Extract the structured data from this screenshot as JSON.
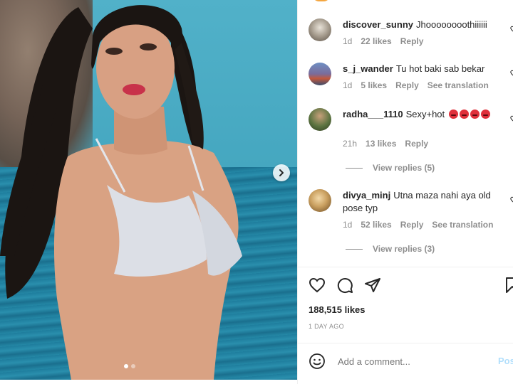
{
  "post": {
    "slide_count": 2,
    "active_slide": 1,
    "likes": "188,515 likes",
    "time_ago": "1 DAY AGO"
  },
  "comments": [
    {
      "user": "discover_sunny",
      "text": "Jhoooooooothiiiiii",
      "time": "1d",
      "likes": "22 likes",
      "reply": "Reply"
    },
    {
      "user": "s_j_wander",
      "text": "Tu hot baki sab bekar",
      "time": "1d",
      "likes": "5 likes",
      "reply": "Reply",
      "translate": "See translation"
    },
    {
      "user": "radha___1110",
      "text": "Sexy+hot",
      "time": "21h",
      "likes": "13 likes",
      "reply": "Reply",
      "view_replies": "View replies (5)"
    },
    {
      "user": "divya_minj",
      "text": "Utna maza nahi aya old pose typ",
      "time": "1d",
      "likes": "52 likes",
      "reply": "Reply",
      "translate": "See translation",
      "view_replies": "View replies (3)"
    }
  ],
  "add_comment": {
    "placeholder": "Add a comment...",
    "post_label": "Post"
  },
  "colors": {
    "link": "#0095f6",
    "muted": "#8e8e8e",
    "text": "#262626",
    "post_disabled": "#b2dffc"
  }
}
